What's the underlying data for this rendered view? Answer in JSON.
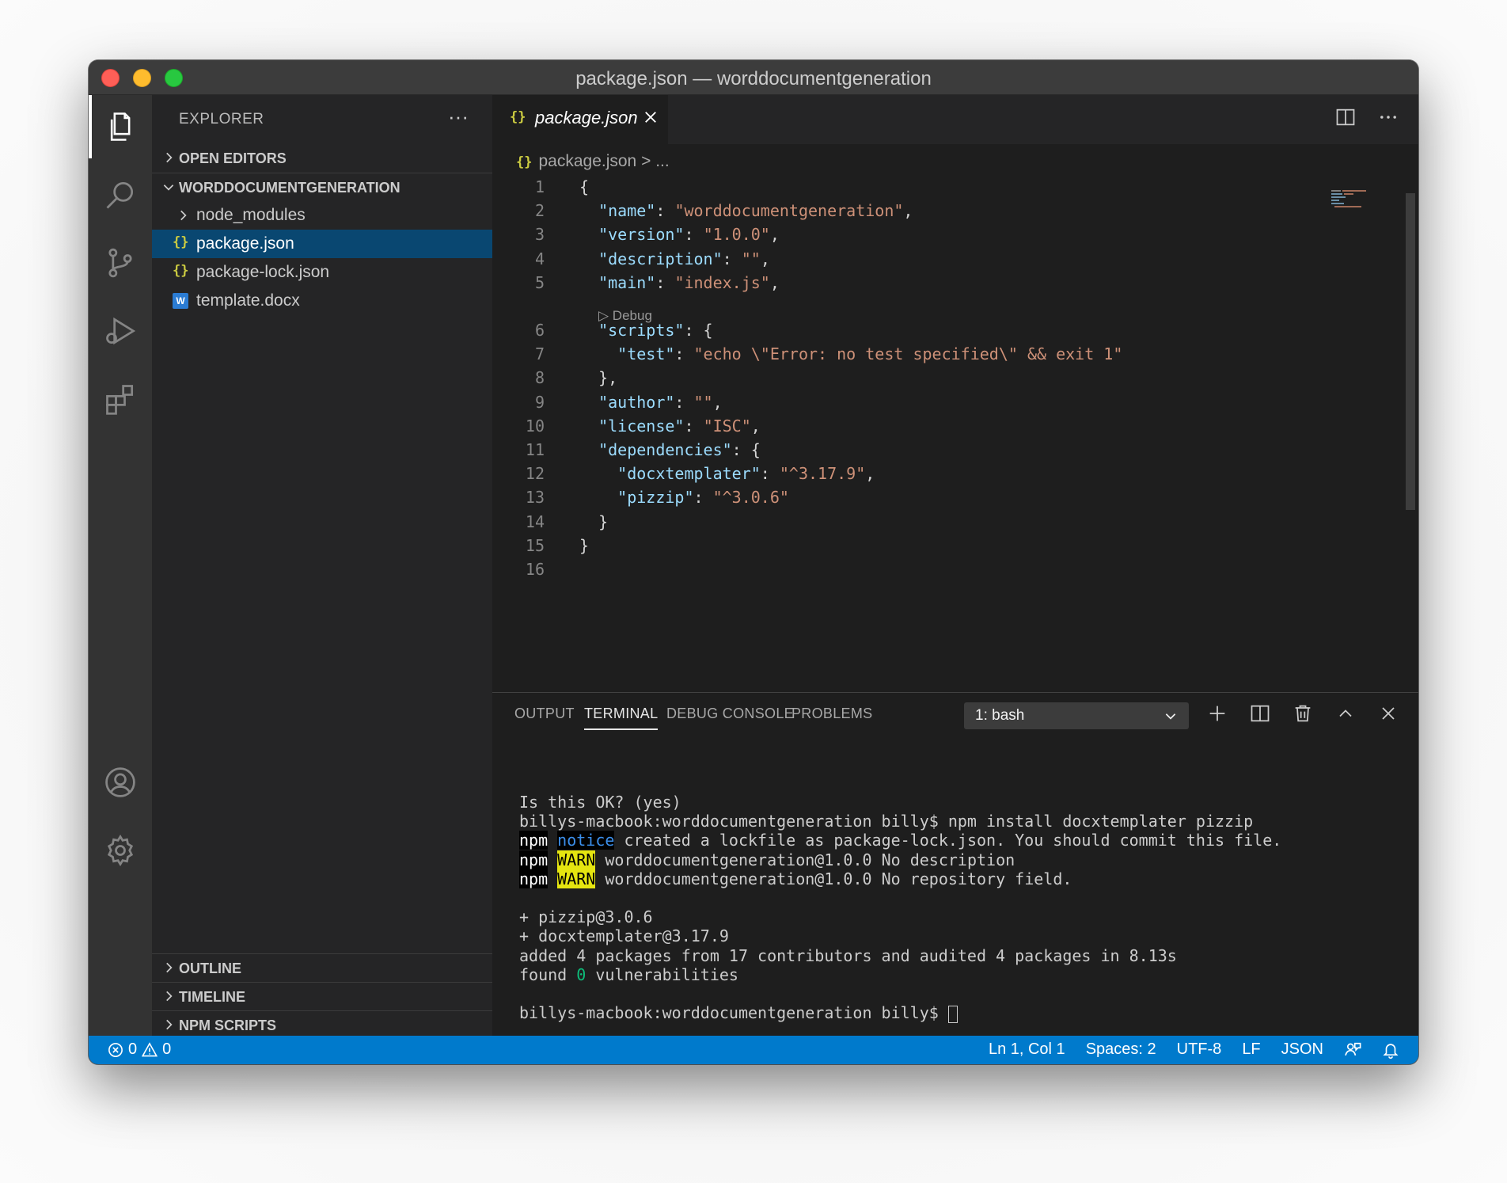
{
  "window": {
    "title": "package.json — worddocumentgeneration"
  },
  "sidebar": {
    "title": "EXPLORER",
    "more": "···",
    "open_editors": "OPEN EDITORS",
    "folder": "WORDDOCUMENTGENERATION",
    "items": [
      {
        "label": "node_modules"
      },
      {
        "label": "package.json"
      },
      {
        "label": "package-lock.json"
      },
      {
        "label": "template.docx"
      }
    ],
    "outline": "OUTLINE",
    "timeline": "TIMELINE",
    "npm_scripts": "NPM SCRIPTS"
  },
  "editor": {
    "tab_label": "package.json",
    "json_icon": "{}",
    "docx_badge": "W",
    "breadcrumb_file": "package.json",
    "breadcrumb_rest": "> ...",
    "codelens": "▷ Debug",
    "lines": [
      {
        "num": "1",
        "parts": [
          {
            "t": "{",
            "c": "p"
          }
        ]
      },
      {
        "num": "2",
        "parts": [
          {
            "t": "  ",
            "c": "p"
          },
          {
            "t": "\"name\"",
            "c": "k"
          },
          {
            "t": ": ",
            "c": "p"
          },
          {
            "t": "\"worddocumentgeneration\"",
            "c": "s"
          },
          {
            "t": ",",
            "c": "p"
          }
        ]
      },
      {
        "num": "3",
        "parts": [
          {
            "t": "  ",
            "c": "p"
          },
          {
            "t": "\"version\"",
            "c": "k"
          },
          {
            "t": ": ",
            "c": "p"
          },
          {
            "t": "\"1.0.0\"",
            "c": "s"
          },
          {
            "t": ",",
            "c": "p"
          }
        ]
      },
      {
        "num": "4",
        "parts": [
          {
            "t": "  ",
            "c": "p"
          },
          {
            "t": "\"description\"",
            "c": "k"
          },
          {
            "t": ": ",
            "c": "p"
          },
          {
            "t": "\"\"",
            "c": "s"
          },
          {
            "t": ",",
            "c": "p"
          }
        ]
      },
      {
        "num": "5",
        "parts": [
          {
            "t": "  ",
            "c": "p"
          },
          {
            "t": "\"main\"",
            "c": "k"
          },
          {
            "t": ": ",
            "c": "p"
          },
          {
            "t": "\"index.js\"",
            "c": "s"
          },
          {
            "t": ",",
            "c": "p"
          }
        ]
      },
      {
        "num": "6",
        "parts": [
          {
            "t": "  ",
            "c": "p"
          },
          {
            "t": "\"scripts\"",
            "c": "k"
          },
          {
            "t": ": {",
            "c": "p"
          }
        ]
      },
      {
        "num": "7",
        "parts": [
          {
            "t": "    ",
            "c": "p"
          },
          {
            "t": "\"test\"",
            "c": "k"
          },
          {
            "t": ": ",
            "c": "p"
          },
          {
            "t": "\"echo \\\"Error: no test specified\\\" && exit 1\"",
            "c": "s"
          }
        ]
      },
      {
        "num": "8",
        "parts": [
          {
            "t": "  },",
            "c": "p"
          }
        ]
      },
      {
        "num": "9",
        "parts": [
          {
            "t": "  ",
            "c": "p"
          },
          {
            "t": "\"author\"",
            "c": "k"
          },
          {
            "t": ": ",
            "c": "p"
          },
          {
            "t": "\"\"",
            "c": "s"
          },
          {
            "t": ",",
            "c": "p"
          }
        ]
      },
      {
        "num": "10",
        "parts": [
          {
            "t": "  ",
            "c": "p"
          },
          {
            "t": "\"license\"",
            "c": "k"
          },
          {
            "t": ": ",
            "c": "p"
          },
          {
            "t": "\"ISC\"",
            "c": "s"
          },
          {
            "t": ",",
            "c": "p"
          }
        ]
      },
      {
        "num": "11",
        "parts": [
          {
            "t": "  ",
            "c": "p"
          },
          {
            "t": "\"dependencies\"",
            "c": "k"
          },
          {
            "t": ": {",
            "c": "p"
          }
        ]
      },
      {
        "num": "12",
        "parts": [
          {
            "t": "    ",
            "c": "p"
          },
          {
            "t": "\"docxtemplater\"",
            "c": "k"
          },
          {
            "t": ": ",
            "c": "p"
          },
          {
            "t": "\"^3.17.9\"",
            "c": "s"
          },
          {
            "t": ",",
            "c": "p"
          }
        ]
      },
      {
        "num": "13",
        "parts": [
          {
            "t": "    ",
            "c": "p"
          },
          {
            "t": "\"pizzip\"",
            "c": "k"
          },
          {
            "t": ": ",
            "c": "p"
          },
          {
            "t": "\"^3.0.6\"",
            "c": "s"
          }
        ]
      },
      {
        "num": "14",
        "parts": [
          {
            "t": "  }",
            "c": "p"
          }
        ]
      },
      {
        "num": "15",
        "parts": [
          {
            "t": "}",
            "c": "p"
          }
        ]
      },
      {
        "num": "16",
        "parts": []
      }
    ]
  },
  "panel": {
    "tabs": [
      "OUTPUT",
      "TERMINAL",
      "DEBUG CONSOLE",
      "PROBLEMS"
    ],
    "active_tab": "TERMINAL",
    "terminal_select": "1: bash",
    "terminal_lines": [
      [
        {
          "t": "Is this OK? (yes)",
          "c": ""
        }
      ],
      [
        {
          "t": "billys-macbook:worddocumentgeneration billy$ npm install docxtemplater pizzip",
          "c": ""
        }
      ],
      [
        {
          "t": "npm",
          "c": "npm"
        },
        {
          "t": " ",
          "c": ""
        },
        {
          "t": "notice",
          "c": "notice"
        },
        {
          "t": " created a lockfile as package-lock.json. You should commit this file.",
          "c": ""
        }
      ],
      [
        {
          "t": "npm",
          "c": "npm"
        },
        {
          "t": " ",
          "c": ""
        },
        {
          "t": "WARN",
          "c": "warn"
        },
        {
          "t": " worddocumentgeneration@1.0.0 No description",
          "c": ""
        }
      ],
      [
        {
          "t": "npm",
          "c": "npm"
        },
        {
          "t": " ",
          "c": ""
        },
        {
          "t": "WARN",
          "c": "warn"
        },
        {
          "t": " worddocumentgeneration@1.0.0 No repository field.",
          "c": ""
        }
      ],
      [
        {
          "t": "",
          "c": ""
        }
      ],
      [
        {
          "t": "+ pizzip@3.0.6",
          "c": ""
        }
      ],
      [
        {
          "t": "+ docxtemplater@3.17.9",
          "c": ""
        }
      ],
      [
        {
          "t": "added 4 packages from 17 contributors and audited 4 packages in 8.13s",
          "c": ""
        }
      ],
      [
        {
          "t": "found ",
          "c": ""
        },
        {
          "t": "0",
          "c": "zero"
        },
        {
          "t": " vulnerabilities",
          "c": ""
        }
      ],
      [
        {
          "t": "",
          "c": ""
        }
      ],
      [
        {
          "t": "billys-macbook:worddocumentgeneration billy$ ",
          "c": ""
        },
        {
          "t": "",
          "c": "cursor"
        }
      ]
    ]
  },
  "statusbar": {
    "errors": "0",
    "warnings": "0",
    "position": "Ln 1, Col 1",
    "spaces": "Spaces: 2",
    "encoding": "UTF-8",
    "eol": "LF",
    "language": "JSON"
  },
  "colors": {
    "statusbar": "#007acc",
    "selection": "#094771",
    "json_icon": "#cbcb41"
  }
}
